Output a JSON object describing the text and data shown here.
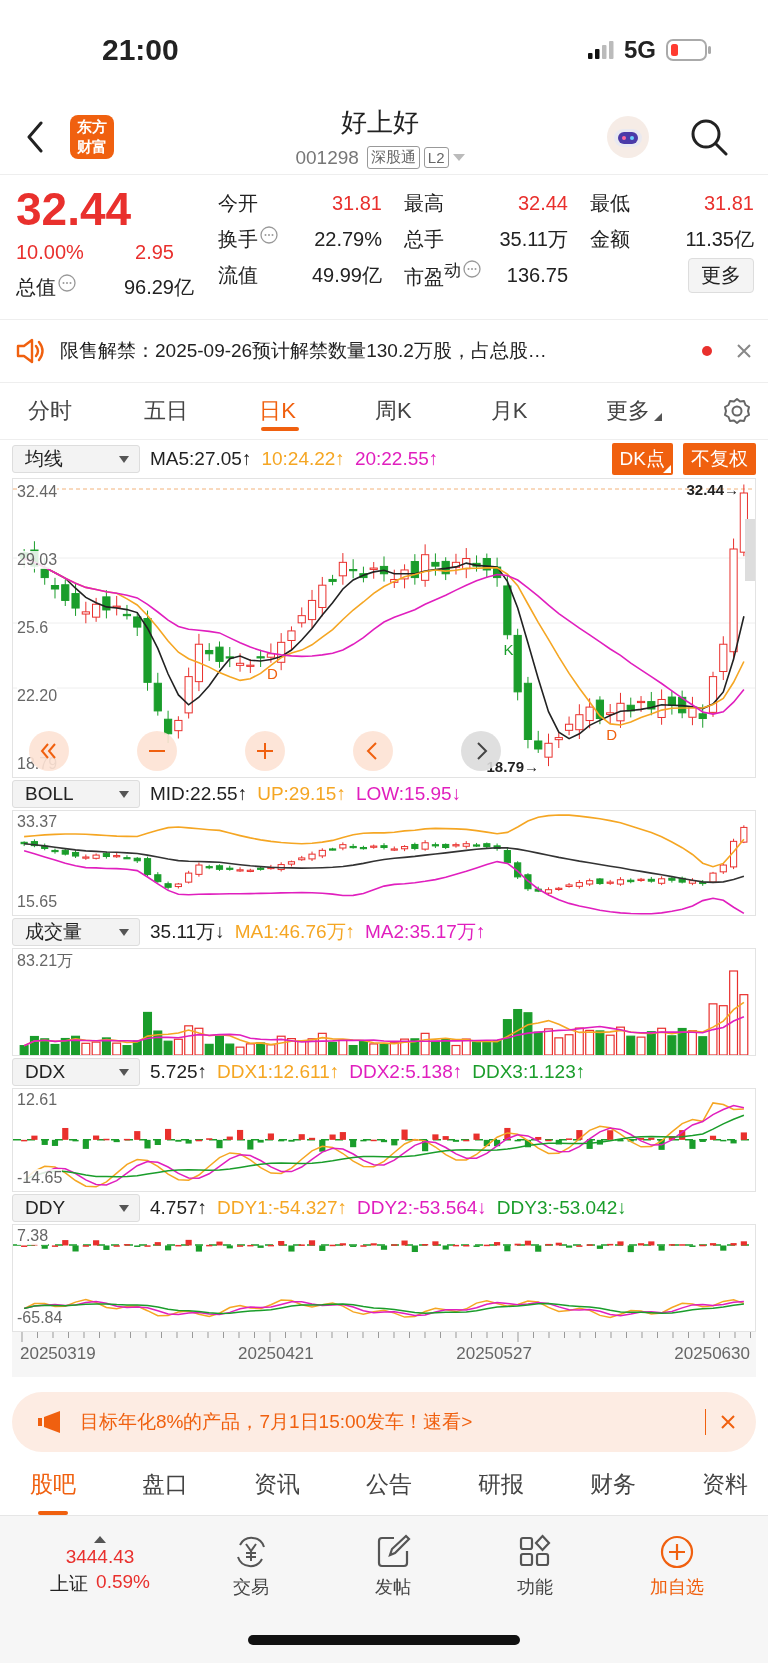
{
  "status_bar": {
    "time": "21:00",
    "network": "5G"
  },
  "header": {
    "logo": "东方财富",
    "title": "好上好",
    "code": "001298",
    "tags": [
      "深股通",
      "L2"
    ]
  },
  "quote": {
    "price": "32.44",
    "change_pct": "10.00%",
    "change": "2.95",
    "market_value": {
      "label": "总值",
      "value": "96.29亿",
      "info": true
    },
    "stats": [
      [
        {
          "label": "今开",
          "value": "31.81",
          "color": "#e9302d",
          "info": false
        },
        {
          "label": "最高",
          "value": "32.44",
          "color": "#e9302d",
          "info": false
        },
        {
          "label": "最低",
          "value": "31.81",
          "color": "#e9302d",
          "info": false
        }
      ],
      [
        {
          "label": "换手",
          "value": "22.79%",
          "color": "#222222",
          "info": true
        },
        {
          "label": "总手",
          "value": "35.11万",
          "color": "#222222",
          "info": false
        },
        {
          "label": "金额",
          "value": "11.35亿",
          "color": "#222222",
          "info": false
        }
      ],
      [
        {
          "label": "流值",
          "value": "49.99亿",
          "color": "#222222",
          "info": false
        },
        {
          "label": "市盈$^{动}$",
          "value": "136.75",
          "color": "#222222",
          "info": true
        }
      ]
    ],
    "more_button": "更多"
  },
  "notice": {
    "text": "限售解禁：2025-09-26预计解禁数量130.2万股，占总股…",
    "unread": true
  },
  "period_tabs": [
    {
      "label": "分时",
      "selected": false,
      "kind": "plain"
    },
    {
      "label": "五日",
      "selected": false,
      "kind": "plain"
    },
    {
      "label": "日K",
      "selected": true,
      "kind": "plain"
    },
    {
      "label": "周K",
      "selected": false,
      "kind": "plain"
    },
    {
      "label": "月K",
      "selected": false,
      "kind": "plain"
    },
    {
      "label": "更多",
      "selected": false,
      "kind": "dropdown"
    }
  ],
  "main_chart": {
    "indicator_select": "均线",
    "legend": [
      {
        "text": "MA5:27.05↑",
        "color": "#222222"
      },
      {
        "text": "10:24.22↑",
        "color": "#f5a623"
      },
      {
        "text": "20:22.55↑",
        "color": "#e01fbe"
      }
    ],
    "buttons": [
      "DK点",
      "不复权"
    ],
    "y_labels": [
      "32.44",
      "29.03",
      "25.6",
      "22.20",
      "18.79"
    ],
    "last_price_label": "32.44→",
    "low_label": "18.79→",
    "markers": [
      {
        "text": "D",
        "color": "#f0600f"
      },
      {
        "text": "K",
        "color": "#1a9d2b"
      },
      {
        "text": "D",
        "color": "#f0600f"
      }
    ]
  },
  "panels": [
    {
      "kind": "boll",
      "select": "BOLL",
      "legend": [
        {
          "text": "MID:22.55↑",
          "color": "#222222"
        },
        {
          "text": "UP:29.15↑",
          "color": "#f5a623"
        },
        {
          "text": "LOW:15.95↓",
          "color": "#e01fbe"
        }
      ],
      "y_labels": [
        "33.37",
        "15.65"
      ]
    },
    {
      "kind": "volume",
      "select": "成交量",
      "legend": [
        {
          "text": "35.11万↓",
          "color": "#222222"
        },
        {
          "text": "MA1:46.76万↑",
          "color": "#f5a623"
        },
        {
          "text": "MA2:35.17万↑",
          "color": "#e01fbe"
        }
      ],
      "y_labels": [
        "83.21万"
      ]
    },
    {
      "kind": "ddx",
      "select": "DDX",
      "legend": [
        {
          "text": "5.725↑",
          "color": "#222222"
        },
        {
          "text": "DDX1:12.611↑",
          "color": "#f5a623"
        },
        {
          "text": "DDX2:5.138↑",
          "color": "#e01fbe"
        },
        {
          "text": "DDX3:1.123↑",
          "color": "#1a9d2b"
        }
      ],
      "y_labels": [
        "12.61",
        "-14.65"
      ]
    },
    {
      "kind": "ddy",
      "select": "DDY",
      "legend": [
        {
          "text": "4.757↑",
          "color": "#222222"
        },
        {
          "text": "DDY1:-54.327↑",
          "color": "#f5a623"
        },
        {
          "text": "DDY2:-53.564↓",
          "color": "#e01fbe"
        },
        {
          "text": "DDY3:-53.042↓",
          "color": "#1a9d2b"
        }
      ],
      "y_labels": [
        "7.38",
        "-65.84"
      ]
    }
  ],
  "dates": [
    "20250319",
    "20250421",
    "20250527",
    "20250630"
  ],
  "banner": {
    "text": "目标年化8%的产品，7月1日15:00发车！速看>"
  },
  "info_tabs": [
    {
      "label": "股吧",
      "selected": true
    },
    {
      "label": "盘口",
      "selected": false
    },
    {
      "label": "资讯",
      "selected": false
    },
    {
      "label": "公告",
      "selected": false
    },
    {
      "label": "研报",
      "selected": false
    },
    {
      "label": "财务",
      "selected": false
    },
    {
      "label": "资料",
      "selected": false
    }
  ],
  "bottom_bar": {
    "index": {
      "value": "3444.43",
      "name": "上证",
      "change": "0.59%"
    },
    "actions": [
      {
        "label": "交易",
        "kind": "trade"
      },
      {
        "label": "发帖",
        "kind": "post"
      },
      {
        "label": "功能",
        "kind": "apps"
      },
      {
        "label": "加自选",
        "kind": "add"
      }
    ]
  }
}
